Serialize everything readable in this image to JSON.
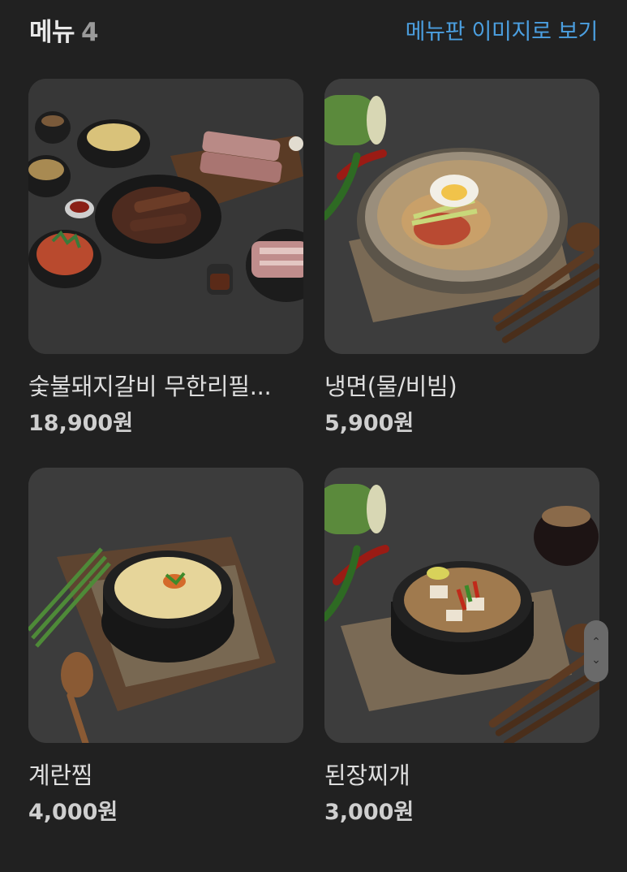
{
  "header": {
    "title": "메뉴",
    "count": "4",
    "view_menu_board_link": "메뉴판 이미지로 보기"
  },
  "menu_items": [
    {
      "name": "숯불돼지갈비 무한리필...",
      "price": "18,900원",
      "image": "pork-galbi-spread"
    },
    {
      "name": "냉면(물/비빔)",
      "price": "5,900원",
      "image": "naengmyeon-bowl"
    },
    {
      "name": "계란찜",
      "price": "4,000원",
      "image": "steamed-egg-pot"
    },
    {
      "name": "된장찌개",
      "price": "3,000원",
      "image": "doenjang-stew-pot"
    }
  ],
  "scroll_handle": {
    "up_icon": "chevron-up-icon",
    "down_icon": "chevron-down-icon"
  },
  "colors": {
    "background": "#212121",
    "link": "#4b9fe0",
    "text": "#dedede"
  }
}
